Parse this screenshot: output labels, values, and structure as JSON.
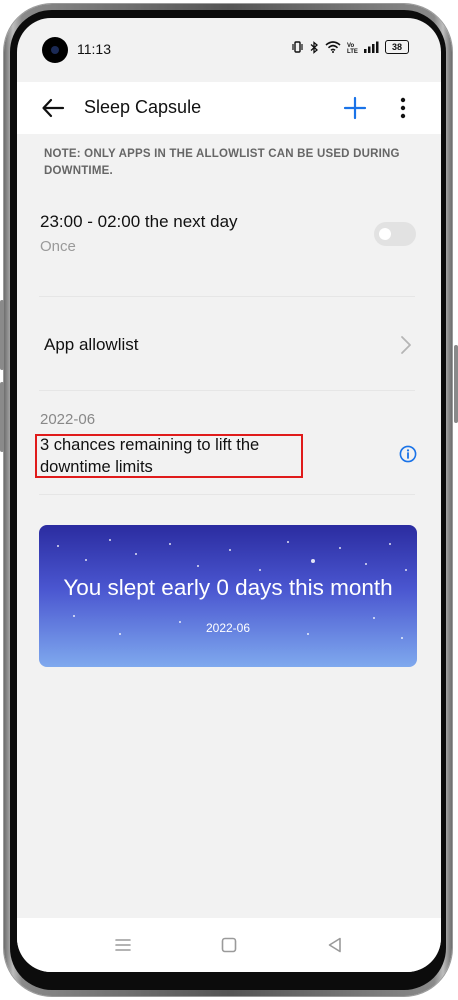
{
  "status_bar": {
    "time": "11:13",
    "battery_level": "38",
    "icons": [
      "vibrate-icon",
      "bluetooth-icon",
      "wifi-icon",
      "volte-icon",
      "signal-icon",
      "battery-icon"
    ]
  },
  "header": {
    "title": "Sleep Capsule",
    "back_icon": "back-arrow-icon",
    "add_icon": "plus-icon",
    "more_icon": "more-vertical-icon",
    "accent_color": "#1a73e8"
  },
  "note": "NOTE: ONLY APPS IN THE ALLOWLIST CAN BE USED DURING DOWNTIME.",
  "schedule": {
    "time_range": "23:00 - 02:00 the next day",
    "repeat": "Once",
    "enabled": false
  },
  "allowlist": {
    "label": "App allowlist"
  },
  "limits": {
    "month": "2022-06",
    "chances_text": "3 chances remaining to lift the downtime limits",
    "highlight_color": "#e01b1b"
  },
  "card": {
    "title": "You slept early 0 days this month",
    "date": "2022-06"
  },
  "navbar": {
    "icons": [
      "menu-icon",
      "home-icon",
      "back-triangle-icon"
    ]
  }
}
